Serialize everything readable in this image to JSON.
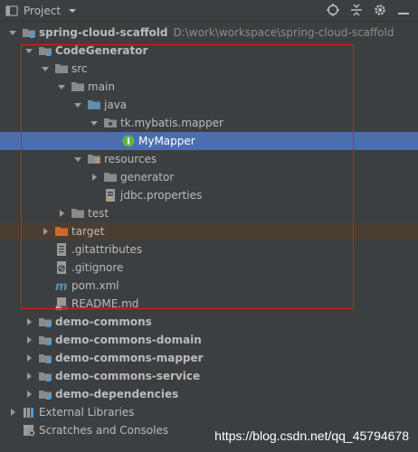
{
  "toolbar": {
    "title": "Project",
    "dropdown_icon": "chevron-down-icon",
    "actions": [
      "locate-icon",
      "collapse-all-icon",
      "gear-icon",
      "hide-icon"
    ]
  },
  "tree": {
    "root": {
      "label": "spring-cloud-scaffold",
      "path": "D:\\work\\workspace\\spring-cloud-scaffold"
    },
    "codegen": {
      "label": "CodeGenerator"
    },
    "src": {
      "label": "src"
    },
    "main": {
      "label": "main"
    },
    "java": {
      "label": "java"
    },
    "package": {
      "label": "tk.mybatis.mapper"
    },
    "mymapper": {
      "label": "MyMapper"
    },
    "resources": {
      "label": "resources"
    },
    "generator": {
      "label": "generator"
    },
    "jdbc": {
      "label": "jdbc.properties"
    },
    "test": {
      "label": "test"
    },
    "target": {
      "label": "target"
    },
    "gitattributes": {
      "label": ".gitattributes"
    },
    "gitignore": {
      "label": ".gitignore"
    },
    "pom": {
      "label": "pom.xml"
    },
    "readme": {
      "label": "README.md"
    },
    "modules": [
      {
        "label": "demo-commons"
      },
      {
        "label": "demo-commons-domain"
      },
      {
        "label": "demo-commons-mapper"
      },
      {
        "label": "demo-commons-service"
      },
      {
        "label": "demo-dependencies"
      }
    ],
    "external": {
      "label": "External Libraries"
    },
    "scratches": {
      "label": "Scratches and Consoles"
    }
  },
  "watermark": "https://blog.csdn.net/qq_45794678",
  "colors": {
    "background": "#3c3f41",
    "selection": "#4b6eaf",
    "excluded": "#4a3d31",
    "highlight_box": "#d91e1e",
    "folder": "#8a8a8a",
    "source_folder": "#5f8ea8",
    "interface_icon": "#62b543"
  }
}
